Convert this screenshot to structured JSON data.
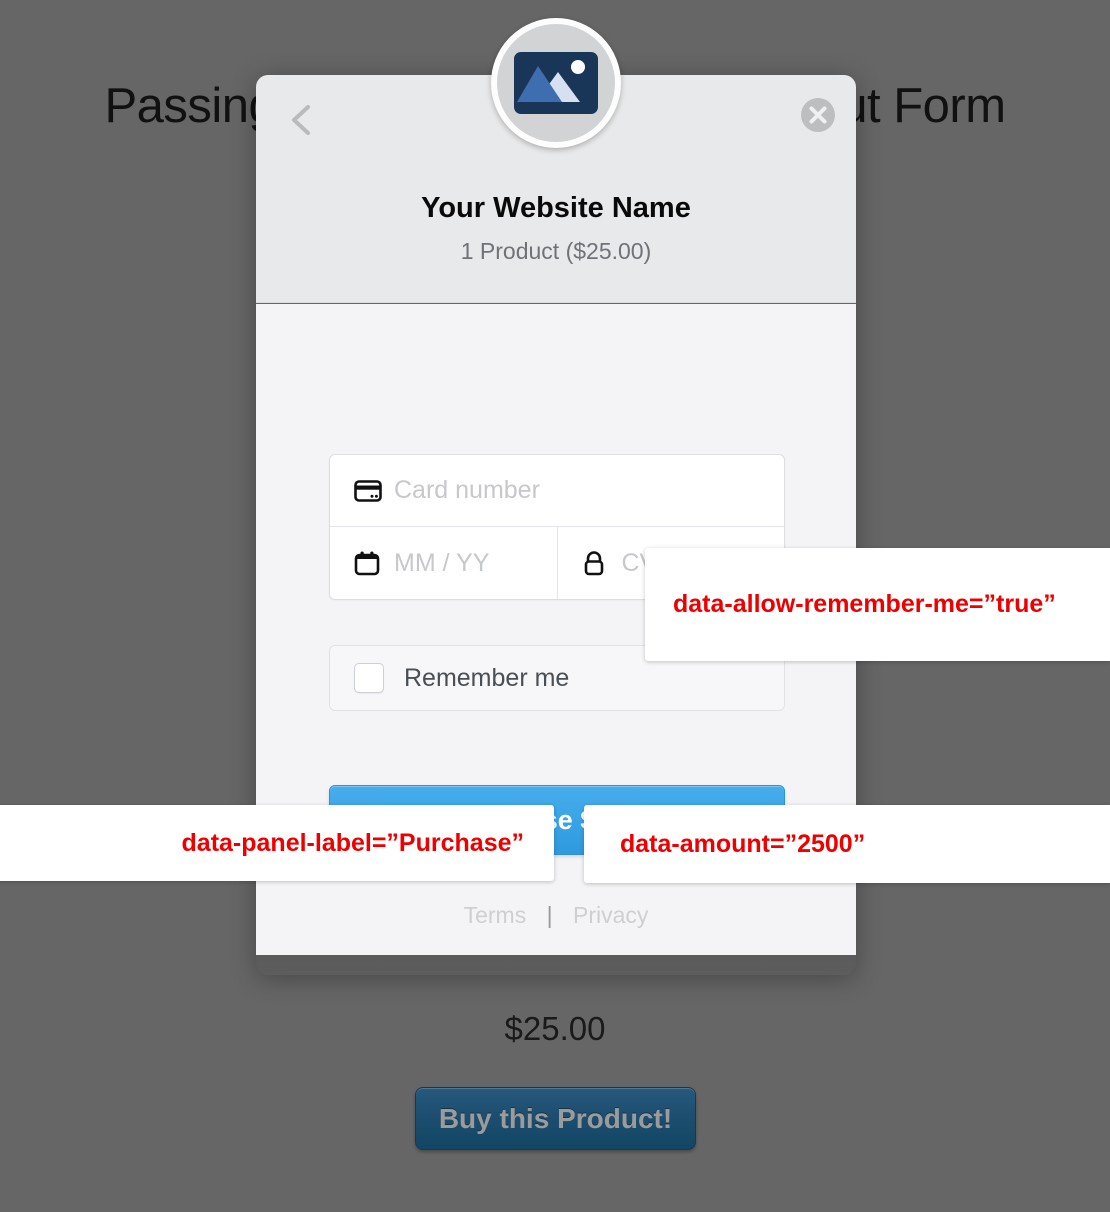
{
  "page": {
    "title": "Passing parameters to the Checkout Form",
    "price": "$25.00",
    "buy_button_label": "Buy this Product!"
  },
  "modal": {
    "back_icon": "chevron-left-icon",
    "close_icon": "close-circle-icon",
    "avatar_icon": "image-placeholder-icon",
    "site_name": "Your Website Name",
    "order_summary": "1 Product ($25.00)",
    "fields": {
      "card_number": {
        "icon": "credit-card-icon",
        "placeholder": "Card number",
        "value": ""
      },
      "expiry": {
        "icon": "calendar-icon",
        "placeholder": "MM / YY",
        "value": ""
      },
      "cvc": {
        "icon": "lock-icon",
        "placeholder": "CVC",
        "value": ""
      }
    },
    "remember_me": {
      "label": "Remember me",
      "checked": false
    },
    "purchase_button_label": "Purchase $25.00",
    "legal": {
      "terms": "Terms",
      "divider": "|",
      "privacy": "Privacy"
    }
  },
  "annotations": {
    "remember_me": "data-allow-remember-me=”true”",
    "panel_label": "data-panel-label=”Purchase”",
    "amount": "data-amount=”2500”"
  },
  "colors": {
    "overlay": "#666666",
    "modal_header_bg": "#e8e9ea",
    "modal_body_bg": "#f4f4f6",
    "primary_button": "#3aa4e6",
    "buy_button": "#1d4e70",
    "annotation_text": "#ee0000",
    "logo_navy": "#193558"
  }
}
